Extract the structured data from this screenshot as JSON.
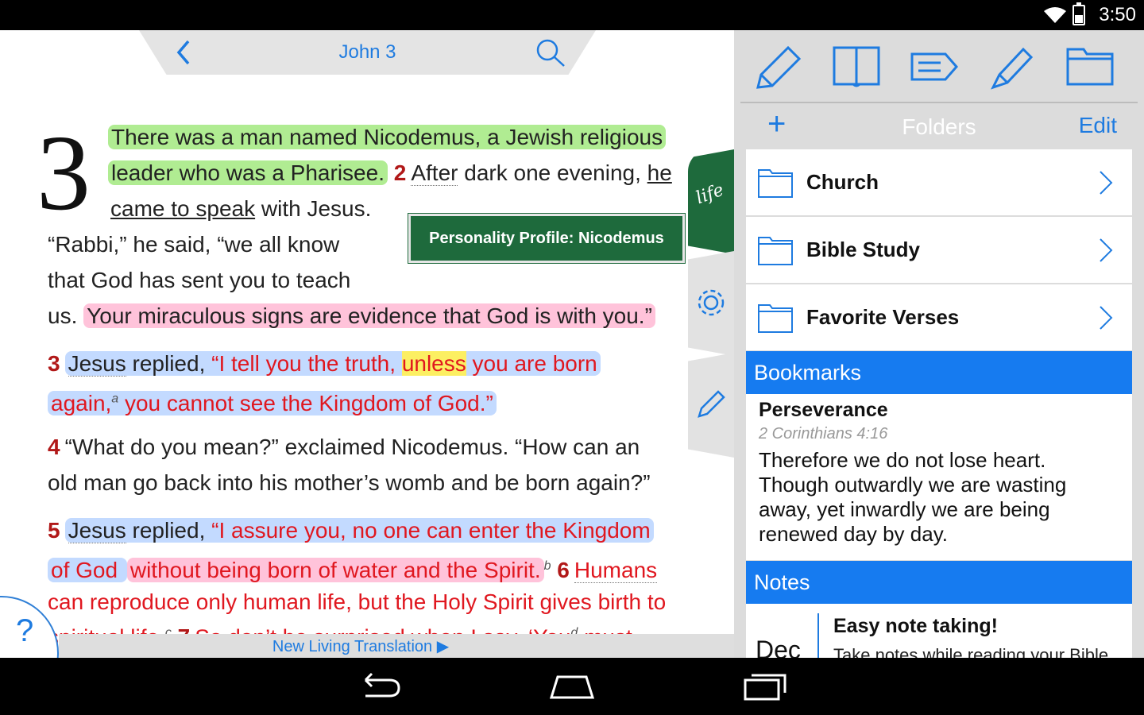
{
  "status": {
    "time": "3:50"
  },
  "reader": {
    "chapter_title": "John 3",
    "chapter_number": "3",
    "profile_tag": "Personality Profile: Nicodemus",
    "side_tab_label": "life APP",
    "translation_link": "New Living Translation ▶",
    "help": "?",
    "lines": {
      "l1": "There was a man named Nicodemus, a Jewish religious",
      "l2a": "leader who was a Pharisee.",
      "l2b": "2",
      "l2c": "After",
      "l2d": " dark one evening, ",
      "l2e": "he",
      "l3a": "came to speak",
      "l3b": " with Jesus.",
      "l4": "“Rabbi,” he said, “we all know",
      "l5": "that God has sent you to teach",
      "l6a": "us. ",
      "l6b": "Your miraculous signs are evidence that God is with you.”",
      "v3n": "3",
      "v3a": "Jesus",
      "v3b": " replied, ",
      "v3c": "“I tell you the truth, ",
      "v3d": "unless",
      "v3e": " you are born",
      "v3f": "again,",
      "v3fn": "a",
      "v3g": " you cannot see the Kingdom of God.”",
      "v4n": "4",
      "v4a": "“What do you mean?” exclaimed Nicodemus. “How can an",
      "v4b": "old man go back into his mother’s womb and be born again?”",
      "v5n": "5",
      "v5a": "Jesus",
      "v5b": " replied, ",
      "v5c": "“I assure you, no one can enter the Kingdom",
      "v5d": "of God ",
      "v5e": "without being born of water and the Spirit.",
      "v5fn": "b",
      "v6n": "6",
      "v6a": "Humans",
      "v6b": "can reproduce only human life, but the Holy Spirit gives birth to",
      "v6c": "spiritual life.",
      "v6fn": "c",
      "v7n": "7",
      "v7a": "So don’t be surprised when I say, ‘You",
      "v7fn": "d",
      "v7b": " must"
    }
  },
  "panel": {
    "tools": [
      "pencil-icon",
      "book-icon",
      "tag-icon",
      "highlighter-icon",
      "folder-icon"
    ],
    "folders_title": "Folders",
    "add": "+",
    "edit": "Edit",
    "folders": [
      {
        "label": "Church"
      },
      {
        "label": "Bible Study"
      },
      {
        "label": "Favorite Verses"
      }
    ],
    "bookmarks_header": "Bookmarks",
    "bookmark": {
      "title": "Perseverance",
      "ref": "2 Corinthians 4:16",
      "text": "Therefore we do not lose heart. Though outwardly we are wasting away, yet inwardly we are being renewed day by day."
    },
    "notes_header": "Notes",
    "note": {
      "date": "Dec",
      "title": "Easy note taking!",
      "body": "Take notes while reading your Bible"
    }
  },
  "colors": {
    "accent": "#1e7be0",
    "header_blue": "#167bf0",
    "life_green": "#1e6a3c",
    "red_letter": "#e0171f"
  }
}
